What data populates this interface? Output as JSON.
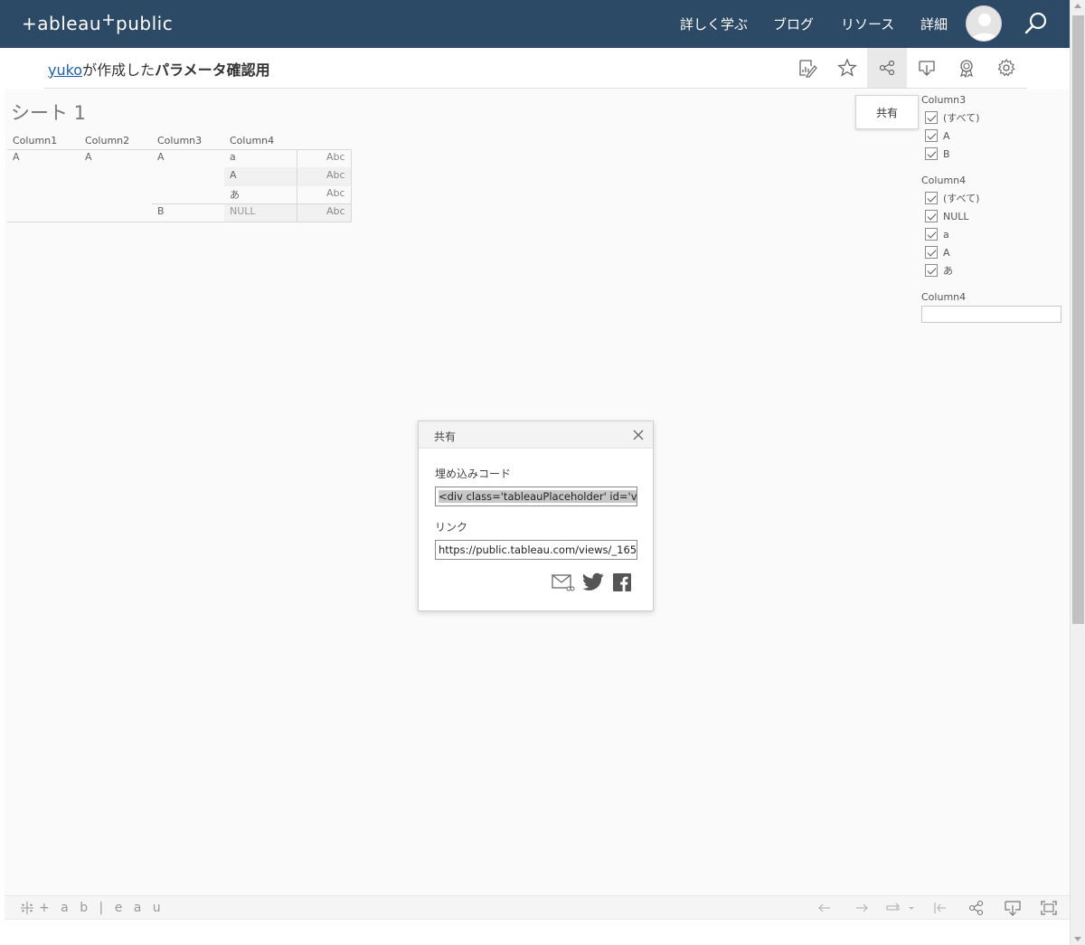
{
  "topnav": {
    "logo": "+ableau",
    "logo_suffix": "public",
    "links": [
      "詳しく学ぶ",
      "ブログ",
      "リソース",
      "詳細"
    ]
  },
  "title": {
    "author": "yuko",
    "made_by": "が作成した",
    "viz_name": "パラメータ確認用"
  },
  "sheet": {
    "title": "シート 1",
    "columns": [
      "Column1",
      "Column2",
      "Column3",
      "Column4"
    ],
    "rows": [
      {
        "c1": "A",
        "c2": "A",
        "c3": "A",
        "c4": "a",
        "value": "Abc"
      },
      {
        "c1": "",
        "c2": "",
        "c3": "",
        "c4": "A",
        "value": "Abc"
      },
      {
        "c1": "",
        "c2": "",
        "c3": "",
        "c4": "あ",
        "value": "Abc"
      },
      {
        "c1": "",
        "c2": "",
        "c3": "B",
        "c4": "NULL",
        "value": "Abc"
      }
    ]
  },
  "share_tooltip": "共有",
  "filters": [
    {
      "title": "Column3",
      "items": [
        "(すべて)",
        "A",
        "B"
      ]
    },
    {
      "title": "Column4",
      "items": [
        "(すべて)",
        "NULL",
        "a",
        "A",
        "あ"
      ]
    }
  ],
  "search_filter": {
    "title": "Column4"
  },
  "dialog": {
    "title": "共有",
    "embed_label": "埋め込みコード",
    "embed_value": "<div class='tableauPlaceholder' id='viz",
    "link_label": "リンク",
    "link_value": "https://public.tableau.com/views/_165"
  },
  "bottombar": {
    "logo": "+ a b | e a u"
  },
  "colors": {
    "nav_bg": "#2c4a66",
    "link": "#1f5fa8"
  }
}
